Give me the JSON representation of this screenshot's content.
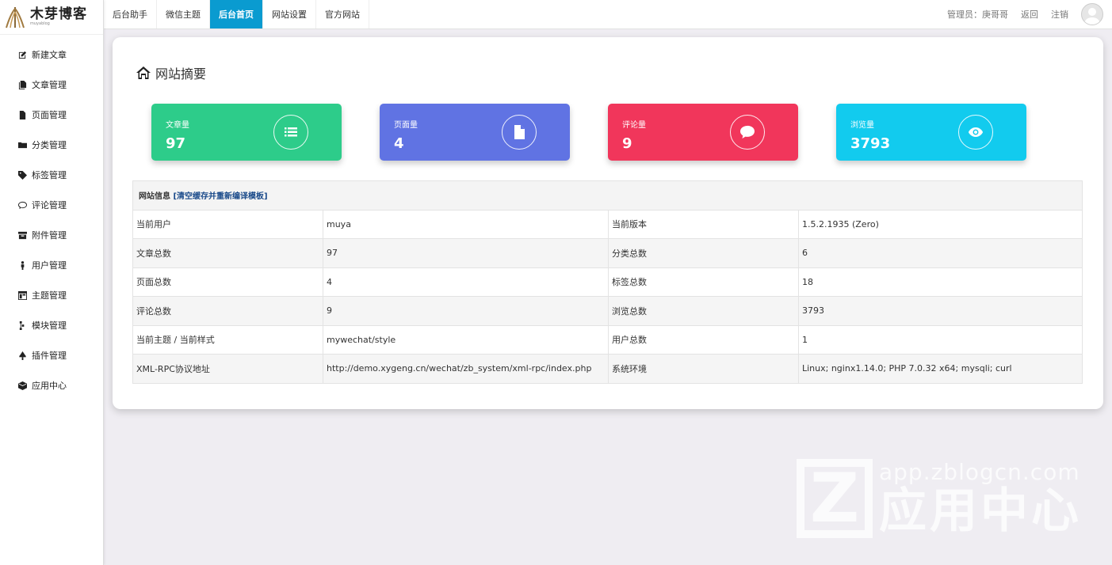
{
  "logo": {
    "title": "木芽博客",
    "subtitle": "muyablog"
  },
  "sidebar": {
    "items": [
      {
        "label": "新建文章",
        "icon": "edit-icon"
      },
      {
        "label": "文章管理",
        "icon": "files-icon"
      },
      {
        "label": "页面管理",
        "icon": "file-icon"
      },
      {
        "label": "分类管理",
        "icon": "folder-icon"
      },
      {
        "label": "标签管理",
        "icon": "tag-icon"
      },
      {
        "label": "评论管理",
        "icon": "comment-icon"
      },
      {
        "label": "附件管理",
        "icon": "archive-icon"
      },
      {
        "label": "用户管理",
        "icon": "user-icon"
      },
      {
        "label": "主题管理",
        "icon": "theme-icon"
      },
      {
        "label": "模块管理",
        "icon": "module-icon"
      },
      {
        "label": "插件管理",
        "icon": "plugin-icon"
      },
      {
        "label": "应用中心",
        "icon": "box-icon"
      }
    ]
  },
  "topbar": {
    "tabs": [
      "后台助手",
      "微信主题",
      "后台首页",
      "网站设置",
      "官方网站"
    ],
    "active_tab": "后台首页",
    "admin": "管理员：庚哥哥",
    "back": "返回",
    "logout": "注销"
  },
  "main": {
    "title": "网站摘要",
    "stats": [
      {
        "label": "文章量",
        "value": "97",
        "color": "#2dcc8a",
        "icon": "list-icon"
      },
      {
        "label": "页面量",
        "value": "4",
        "color": "#6073e3",
        "icon": "file-icon"
      },
      {
        "label": "评论量",
        "value": "9",
        "color": "#f1365b",
        "icon": "comment-icon"
      },
      {
        "label": "浏览量",
        "value": "3793",
        "color": "#12cbee",
        "icon": "eye-icon"
      }
    ],
    "info": {
      "header": "网站信息",
      "refresh_link": "[清空缓存并重新编译模板]",
      "rows": [
        [
          "当前用户",
          "muya",
          "当前版本",
          "1.5.2.1935 (Zero)"
        ],
        [
          "文章总数",
          "97",
          "分类总数",
          "6"
        ],
        [
          "页面总数",
          "4",
          "标签总数",
          "18"
        ],
        [
          "评论总数",
          "9",
          "浏览总数",
          "3793"
        ],
        [
          "当前主题 / 当前样式",
          "mywechat/style",
          "用户总数",
          "1"
        ],
        [
          "XML-RPC协议地址",
          "http://demo.xygeng.cn/wechat/zb_system/xml-rpc/index.php",
          "系统环境",
          "Linux; nginx1.14.0; PHP 7.0.32 x64; mysqli; curl"
        ]
      ]
    }
  },
  "watermark": {
    "letter": "Z",
    "url": "app.zblogcn.com",
    "text": "应用中心"
  }
}
